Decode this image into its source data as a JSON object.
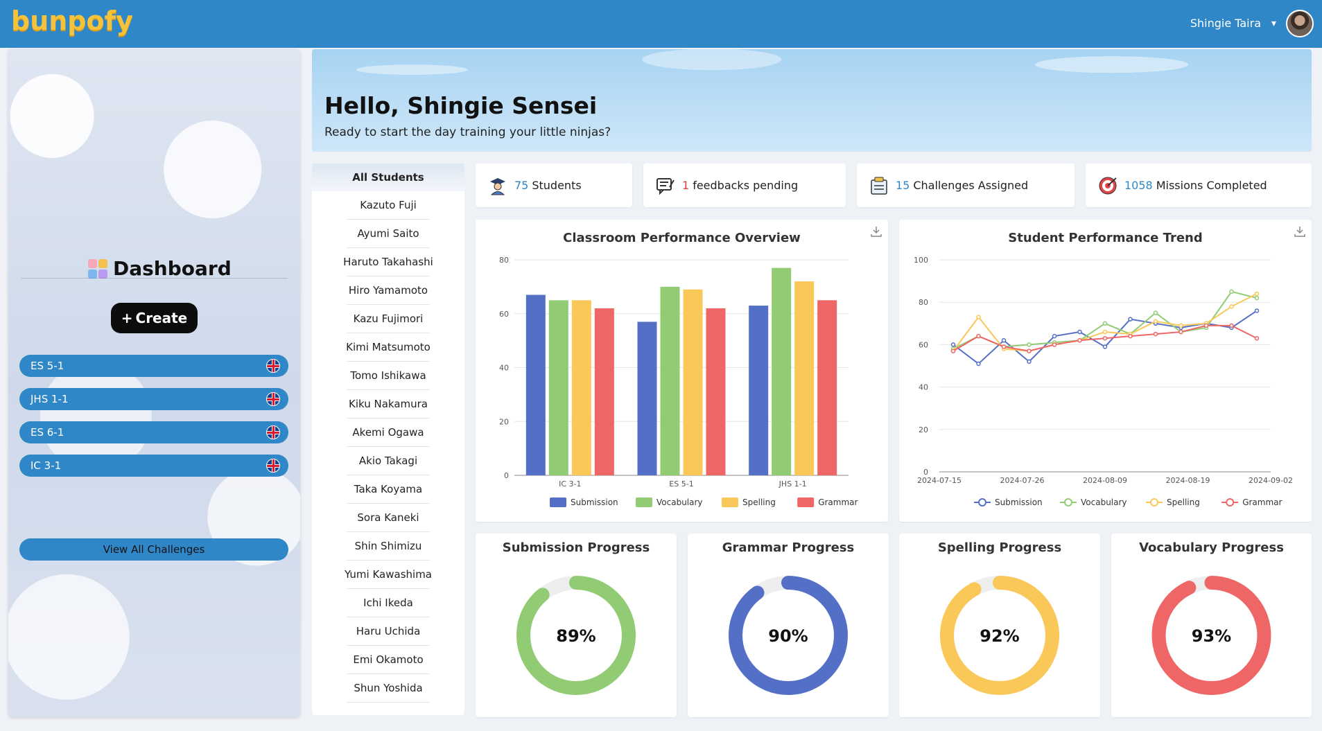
{
  "app": {
    "logo": "bunpofy"
  },
  "user": {
    "name": "Shingie Taira",
    "caret": "▾"
  },
  "sidebar": {
    "title": "Dashboard",
    "create_label": "Create",
    "classes": [
      {
        "label": "ES 5-1"
      },
      {
        "label": "JHS 1-1"
      },
      {
        "label": "ES 6-1"
      },
      {
        "label": "IC 3-1"
      }
    ],
    "view_all_label": "View All Challenges"
  },
  "banner": {
    "title": "Hello, Shingie Sensei",
    "subtitle": "Ready to start the day training your little ninjas?"
  },
  "students": {
    "header": "All Students",
    "items": [
      "Kazuto Fuji",
      "Ayumi Saito",
      "Haruto Takahashi",
      "Hiro Yamamoto",
      "Kazu Fujimori",
      "Kimi Matsumoto",
      "Tomo Ishikawa",
      "Kiku Nakamura",
      "Akemi Ogawa",
      "Akio Takagi",
      "Taka Koyama",
      "Sora Kaneki",
      "Shin Shimizu",
      "Yumi Kawashima",
      "Ichi Ikeda",
      "Haru Uchida",
      "Emi Okamoto",
      "Shun Yoshida"
    ]
  },
  "stats": [
    {
      "num": "75",
      "label": "Students",
      "icon": "student-icon"
    },
    {
      "num": "1",
      "label": "feedbacks pending",
      "icon": "feedback-icon"
    },
    {
      "num": "15",
      "label": "Challenges Assigned",
      "icon": "challenge-icon"
    },
    {
      "num": "1058",
      "label": "Missions Completed",
      "icon": "target-icon"
    }
  ],
  "colors": {
    "submission": "#5470c6",
    "vocabulary": "#91cc75",
    "spelling": "#fac858",
    "grammar": "#ee6666",
    "accent": "#2f87c8"
  },
  "chart_data": [
    {
      "type": "bar",
      "title": "Classroom Performance Overview",
      "categories": [
        "IC 3-1",
        "ES 5-1",
        "JHS 1-1"
      ],
      "series": [
        {
          "name": "Submission",
          "values": [
            67,
            57,
            63
          ]
        },
        {
          "name": "Vocabulary",
          "values": [
            65,
            70,
            77
          ]
        },
        {
          "name": "Spelling",
          "values": [
            65,
            69,
            72
          ]
        },
        {
          "name": "Grammar",
          "values": [
            62,
            62,
            65
          ]
        }
      ],
      "ylim": [
        0,
        80
      ],
      "yticks": [
        0,
        20,
        40,
        60,
        80
      ],
      "legend": "bottom"
    },
    {
      "type": "line",
      "title": "Student Performance Trend",
      "x": [
        "2024-07-15",
        "2024-07-18",
        "2024-07-22",
        "2024-07-24",
        "2024-07-26",
        "2024-07-29",
        "2024-08-02",
        "2024-08-06",
        "2024-08-09",
        "2024-08-13",
        "2024-08-16",
        "2024-08-19",
        "2024-08-23",
        "2024-08-27",
        "2024-08-30",
        "2024-09-02"
      ],
      "xticks": [
        "2024-07-15",
        "2024-07-26",
        "2024-08-09",
        "2024-08-19",
        "2024-09-02"
      ],
      "series": [
        {
          "name": "Submission",
          "values": [
            60,
            51,
            62,
            52,
            64,
            66,
            59,
            72,
            70,
            68,
            70,
            68,
            76
          ]
        },
        {
          "name": "Vocabulary",
          "values": [
            58,
            64,
            59,
            60,
            61,
            62,
            70,
            65,
            75,
            66,
            68,
            85,
            82
          ]
        },
        {
          "name": "Spelling",
          "values": [
            57,
            73,
            58,
            57,
            60,
            62,
            66,
            65,
            71,
            69,
            70,
            78,
            84
          ]
        },
        {
          "name": "Grammar",
          "values": [
            57,
            64,
            59,
            57,
            60,
            62,
            63,
            64,
            65,
            66,
            69,
            69,
            63
          ]
        }
      ],
      "ylim": [
        0,
        100
      ],
      "yticks": [
        0,
        20,
        40,
        60,
        80,
        100
      ],
      "legend": "bottom"
    },
    {
      "type": "pie",
      "title": "Submission Progress",
      "value": 89,
      "label": "89%"
    },
    {
      "type": "pie",
      "title": "Grammar Progress",
      "value": 90,
      "label": "90%"
    },
    {
      "type": "pie",
      "title": "Spelling Progress",
      "value": 92,
      "label": "92%"
    },
    {
      "type": "pie",
      "title": "Vocabulary Progress",
      "value": 93,
      "label": "93%"
    }
  ]
}
